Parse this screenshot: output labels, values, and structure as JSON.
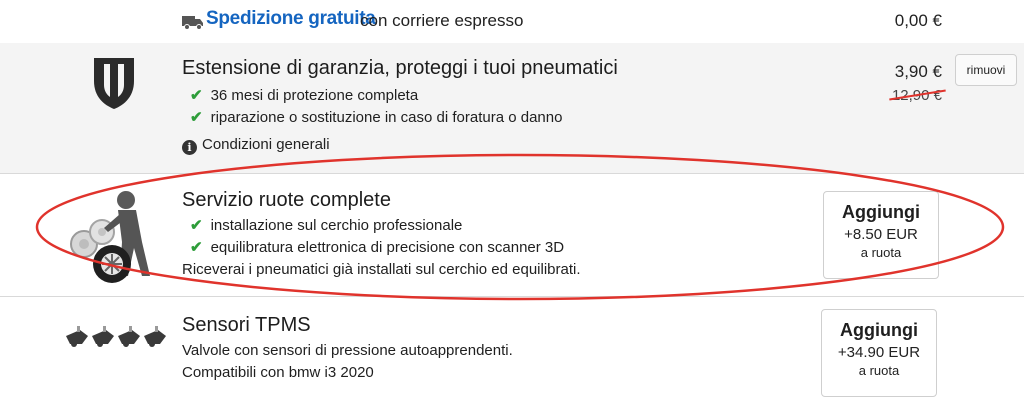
{
  "shipping": {
    "icon": "truck-icon",
    "title": "Spedizione gratuita",
    "subtitle": "con corriere espresso",
    "price": "0,00 €"
  },
  "warranty": {
    "icon": "shield-icon",
    "title": "Estensione di garanzia, proteggi i tuoi pneumatici",
    "features": [
      "36 mesi di protezione completa",
      "riparazione o sostituzione in caso di foratura o danno"
    ],
    "terms_label": "Condizioni generali",
    "price": "3,90 €",
    "old_price": "12,90 €",
    "remove_label": "rimuovi"
  },
  "wheel_service": {
    "icon": "mechanic-wheel-icon",
    "title": "Servizio ruote complete",
    "features": [
      "installazione sul cerchio professionale",
      "equilibratura elettronica di precisione con scanner 3D"
    ],
    "note": "Riceverai i pneumatici già installati sul cerchio ed equilibrati.",
    "button": {
      "label": "Aggiungi",
      "price": "+8.50 EUR",
      "unit": "a ruota"
    }
  },
  "tpms": {
    "icon": "tpms-sensor-icon",
    "title": "Sensori TPMS",
    "description": "Valvole con sensori di pressione autoapprendenti.",
    "compatibility": "Compatibili con bmw i3 2020",
    "button": {
      "label": "Aggiungi",
      "price": "+34.90 EUR",
      "unit": "a ruota"
    }
  },
  "colors": {
    "highlight_ellipse": "#e0332c",
    "check": "#2e9d3a",
    "shipping_title": "#1565c0"
  }
}
